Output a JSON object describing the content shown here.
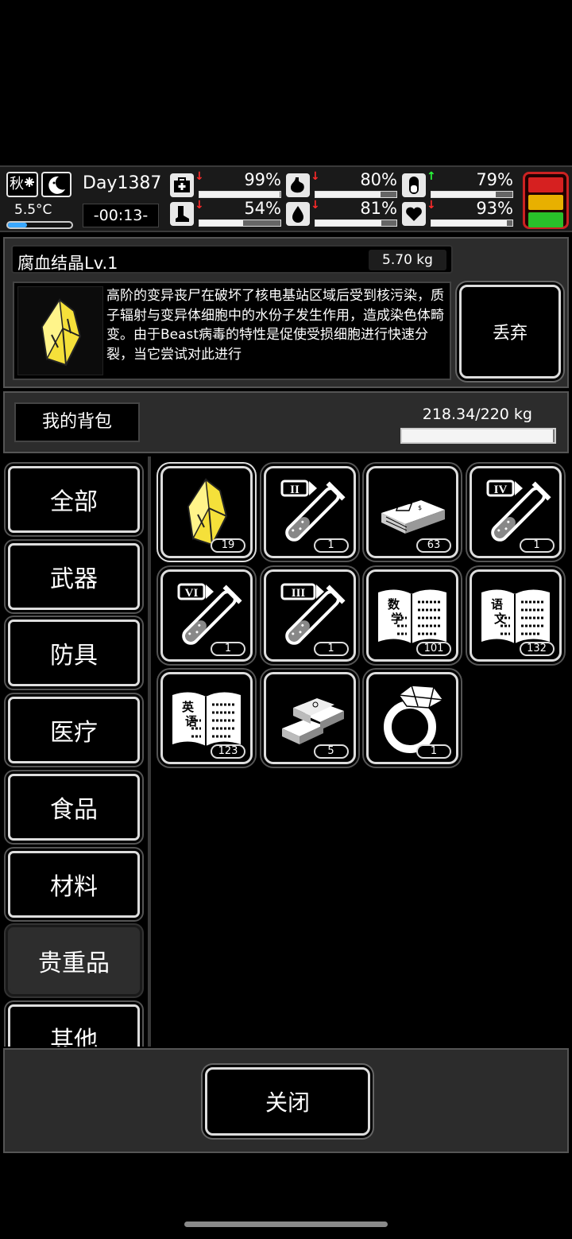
{
  "status": {
    "season": "秋",
    "temperature": "5.5°C",
    "temperature_level": 0.3,
    "day": "Day1387",
    "clock": "-00:13-",
    "stats": [
      {
        "name": "health",
        "icon": "medkit-icon",
        "value": "99%",
        "level": 0.99,
        "trend": "down"
      },
      {
        "name": "hunger",
        "icon": "stomach-icon",
        "value": "80%",
        "level": 0.8,
        "trend": "down"
      },
      {
        "name": "pill",
        "icon": "pill-icon",
        "value": "79%",
        "level": 0.79,
        "trend": "up"
      },
      {
        "name": "stamina",
        "icon": "boot-icon",
        "value": "54%",
        "level": 0.54,
        "trend": "down"
      },
      {
        "name": "thirst",
        "icon": "water-drop-icon",
        "value": "81%",
        "level": 0.81,
        "trend": "down"
      },
      {
        "name": "mood",
        "icon": "heart-icon",
        "value": "93%",
        "level": 0.93,
        "trend": "down"
      }
    ],
    "lights": [
      "#d62020",
      "#e8b000",
      "#29c02a"
    ]
  },
  "detail": {
    "name": "腐血结晶Lv.1",
    "weight": "5.70 kg",
    "description": "高阶的变异丧尸在破坏了核电基站区域后受到核污染，质子辐射与变异体细胞中的水份子发生作用，造成染色体畸变。由于Beast病毒的特性是促使受损细胞进行快速分裂，当它尝试对此进行",
    "discard_label": "丢弃"
  },
  "bag": {
    "title": "我的背包",
    "weight": "218.34/220 kg",
    "fill": 0.992
  },
  "categories": [
    {
      "label": "全部",
      "active": false
    },
    {
      "label": "武器",
      "active": false
    },
    {
      "label": "防具",
      "active": false
    },
    {
      "label": "医疗",
      "active": false
    },
    {
      "label": "食品",
      "active": false
    },
    {
      "label": "材料",
      "active": false
    },
    {
      "label": "贵重品",
      "active": true
    },
    {
      "label": "其他",
      "active": false
    }
  ],
  "items": [
    {
      "icon": "crystal-icon",
      "count": "19",
      "selected": true
    },
    {
      "icon": "test-tube-ii-icon",
      "roman": "II",
      "count": "1",
      "selected": false
    },
    {
      "icon": "cash-stack-icon",
      "count": "63",
      "selected": false
    },
    {
      "icon": "test-tube-iv-icon",
      "roman": "IV",
      "count": "1",
      "selected": false
    },
    {
      "icon": "test-tube-vi-icon",
      "roman": "VI",
      "count": "1",
      "selected": false
    },
    {
      "icon": "test-tube-iii-icon",
      "roman": "III",
      "count": "1",
      "selected": false
    },
    {
      "icon": "math-book-icon",
      "book": "数学",
      "count": "101",
      "selected": false
    },
    {
      "icon": "chinese-book-icon",
      "book": "语文",
      "count": "132",
      "selected": false
    },
    {
      "icon": "english-book-icon",
      "book": "英语",
      "count": "123",
      "selected": false
    },
    {
      "icon": "gold-bars-icon",
      "count": "5",
      "selected": false
    },
    {
      "icon": "diamond-ring-icon",
      "count": "1",
      "selected": false
    }
  ],
  "footer": {
    "close_label": "关闭"
  }
}
